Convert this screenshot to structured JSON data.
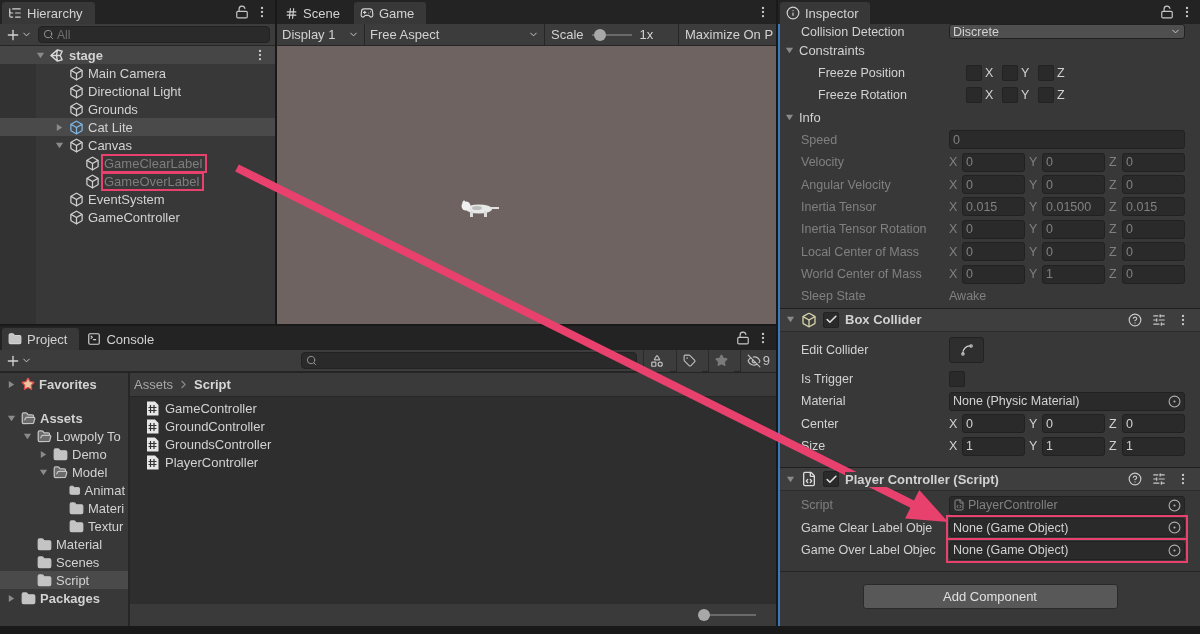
{
  "hierarchy": {
    "title": "Hierarchy",
    "search": {
      "placeholder": "All"
    },
    "scene": {
      "name": "stage",
      "expanded": true
    },
    "items": [
      {
        "name": "Main Camera",
        "kind": "object",
        "selected": false,
        "disabled": false,
        "highlighted": false
      },
      {
        "name": "Directional Light",
        "kind": "object",
        "selected": false,
        "disabled": false,
        "highlighted": false
      },
      {
        "name": "Grounds",
        "kind": "object",
        "selected": false,
        "disabled": false,
        "highlighted": false
      },
      {
        "name": "Cat Lite",
        "kind": "prefab",
        "expanded": false,
        "selected": true,
        "disabled": false,
        "highlighted": false
      },
      {
        "name": "Canvas",
        "kind": "object",
        "expanded": true,
        "selected": false,
        "disabled": false,
        "highlighted": false,
        "children": [
          {
            "name": "GameClearLabel",
            "kind": "object",
            "selected": false,
            "disabled": true,
            "highlighted": true
          },
          {
            "name": "GameOverLabel",
            "kind": "object",
            "selected": false,
            "disabled": true,
            "highlighted": true
          }
        ]
      },
      {
        "name": "EventSystem",
        "kind": "object",
        "selected": false,
        "disabled": false,
        "highlighted": false
      },
      {
        "name": "GameController",
        "kind": "object",
        "selected": false,
        "disabled": false,
        "highlighted": false
      }
    ]
  },
  "game": {
    "tabs": [
      {
        "label": "Scene",
        "kind": "scene",
        "selected": false
      },
      {
        "label": "Game",
        "kind": "game",
        "selected": true
      }
    ],
    "display": "Display 1",
    "aspect": "Free Aspect",
    "scale": {
      "label": "Scale",
      "level": 0.1,
      "reading": "1x"
    },
    "maximize": "Maximize On P"
  },
  "inspector": {
    "title": "Inspector",
    "rows": [
      {
        "kind": "dropdown",
        "label": "Collision Detection",
        "value": "Discrete",
        "disabled": false
      },
      {
        "kind": "foldout",
        "label": "Constraints",
        "expanded": true,
        "disabled": false
      },
      {
        "kind": "toggles",
        "label": "Freeze Position",
        "disabled": false,
        "axes": [
          {
            "axis": "X",
            "checked": false
          },
          {
            "axis": "Y",
            "checked": false
          },
          {
            "axis": "Z",
            "checked": false
          }
        ]
      },
      {
        "kind": "toggles",
        "label": "Freeze Rotation",
        "disabled": false,
        "axes": [
          {
            "axis": "X",
            "checked": false
          },
          {
            "axis": "Y",
            "checked": false
          },
          {
            "axis": "Z",
            "checked": false
          }
        ]
      },
      {
        "kind": "foldout",
        "label": "Info",
        "expanded": true,
        "disabled": false
      },
      {
        "kind": "field",
        "label": "Speed",
        "value": "0",
        "disabled": true
      },
      {
        "kind": "vector",
        "label": "Velocity",
        "disabled": true,
        "values": [
          {
            "axis": "X",
            "value": "0"
          },
          {
            "axis": "Y",
            "value": "0"
          },
          {
            "axis": "Z",
            "value": "0"
          }
        ]
      },
      {
        "kind": "vector",
        "label": "Angular Velocity",
        "disabled": true,
        "values": [
          {
            "axis": "X",
            "value": "0"
          },
          {
            "axis": "Y",
            "value": "0"
          },
          {
            "axis": "Z",
            "value": "0"
          }
        ]
      },
      {
        "kind": "vector",
        "label": "Inertia Tensor",
        "disabled": true,
        "values": [
          {
            "axis": "X",
            "value": "0.015"
          },
          {
            "axis": "Y",
            "value": "0.01500"
          },
          {
            "axis": "Z",
            "value": "0.015"
          }
        ]
      },
      {
        "kind": "vector",
        "label": "Inertia Tensor Rotation",
        "disabled": true,
        "values": [
          {
            "axis": "X",
            "value": "0"
          },
          {
            "axis": "Y",
            "value": "0"
          },
          {
            "axis": "Z",
            "value": "0"
          }
        ]
      },
      {
        "kind": "vector",
        "label": "Local Center of Mass",
        "disabled": true,
        "values": [
          {
            "axis": "X",
            "value": "0"
          },
          {
            "axis": "Y",
            "value": "0"
          },
          {
            "axis": "Z",
            "value": "0"
          }
        ]
      },
      {
        "kind": "vector",
        "label": "World Center of Mass",
        "disabled": true,
        "values": [
          {
            "axis": "X",
            "value": "0"
          },
          {
            "axis": "Y",
            "value": "1"
          },
          {
            "axis": "Z",
            "value": "0"
          }
        ]
      },
      {
        "kind": "text",
        "label": "Sleep State",
        "value": "Awake",
        "disabled": true
      }
    ],
    "components": [
      {
        "title": "Box Collider",
        "kind": "collider",
        "expanded": true,
        "enabled": true,
        "rows": [
          {
            "kind": "button",
            "label": "Edit Collider",
            "disabled": false,
            "highlighted": false
          },
          {
            "kind": "checkbox",
            "label": "Is Trigger",
            "checked": false,
            "disabled": false,
            "highlighted": false
          },
          {
            "kind": "object",
            "label": "Material",
            "value": "None (Physic Material)",
            "disabled": false,
            "highlighted": false
          },
          {
            "kind": "vector",
            "label": "Center",
            "disabled": false,
            "highlighted": false,
            "values": [
              {
                "axis": "X",
                "value": "0"
              },
              {
                "axis": "Y",
                "value": "0"
              },
              {
                "axis": "Z",
                "value": "0"
              }
            ]
          },
          {
            "kind": "vector",
            "label": "Size",
            "disabled": false,
            "highlighted": false,
            "values": [
              {
                "axis": "X",
                "value": "1"
              },
              {
                "axis": "Y",
                "value": "1"
              },
              {
                "axis": "Z",
                "value": "1"
              }
            ]
          }
        ]
      },
      {
        "title": "Player Controller (Script)",
        "kind": "script",
        "expanded": true,
        "enabled": true,
        "rows": [
          {
            "kind": "object",
            "label": "Script",
            "value": "PlayerController",
            "disabled": true,
            "highlighted": false
          },
          {
            "kind": "object",
            "label": "Game Clear Label Obje",
            "value": "None (Game Object)",
            "disabled": false,
            "highlighted": true
          },
          {
            "kind": "object",
            "label": "Game Over Label Objec",
            "value": "None (Game Object)",
            "disabled": false,
            "highlighted": true
          }
        ]
      }
    ],
    "add_button": "Add Component"
  },
  "project": {
    "tabs": [
      {
        "label": "Project",
        "kind": "project",
        "selected": true
      },
      {
        "label": "Console",
        "kind": "console",
        "selected": false
      }
    ],
    "hidden_count": "9",
    "tree": [
      {
        "name": "Favorites",
        "kind": "favorites",
        "expanded": false,
        "selected": false
      },
      {
        "name": "Assets",
        "kind": "folder",
        "expanded": true,
        "selected": false,
        "children": [
          {
            "name": "Lowpoly To",
            "kind": "folder",
            "expanded": true,
            "selected": false,
            "children": [
              {
                "name": "Demo",
                "kind": "folder",
                "expanded": false,
                "selected": false
              },
              {
                "name": "Model",
                "kind": "folder",
                "expanded": true,
                "selected": false,
                "children": [
                  {
                    "name": "Animat",
                    "kind": "folder",
                    "selected": false
                  },
                  {
                    "name": "Materi",
                    "kind": "folder",
                    "selected": false
                  },
                  {
                    "name": "Textur",
                    "kind": "folder",
                    "selected": false
                  }
                ]
              }
            ]
          },
          {
            "name": "Material",
            "kind": "folder",
            "selected": false
          },
          {
            "name": "Scenes",
            "kind": "folder",
            "selected": false
          },
          {
            "name": "Script",
            "kind": "folder",
            "selected": true
          }
        ]
      },
      {
        "name": "Packages",
        "kind": "folder",
        "expanded": false,
        "selected": false
      }
    ],
    "breadcrumb": [
      "Assets",
      "Script"
    ],
    "files": [
      "GameController",
      "GroundController",
      "GroundsController",
      "PlayerController"
    ],
    "zoom": {
      "level": 0
    }
  },
  "annotations": {
    "arrow": true
  }
}
